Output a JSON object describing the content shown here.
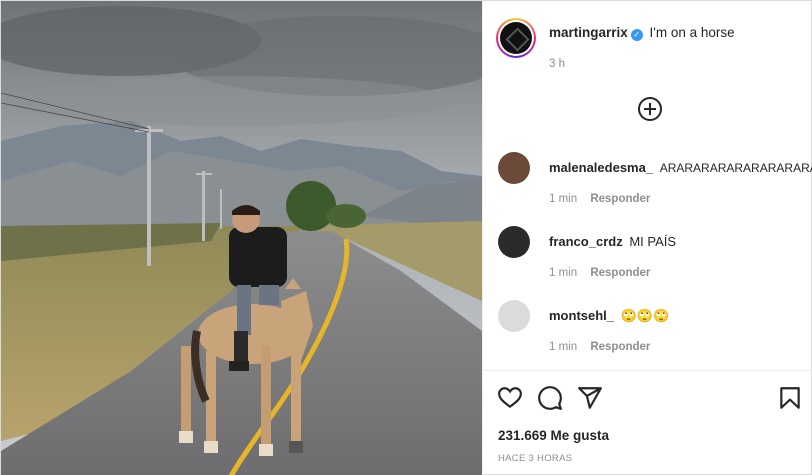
{
  "post": {
    "username": "martingarrix",
    "caption": "I'm on a horse",
    "time": "3 h",
    "verified_icon": "verified-badge-icon"
  },
  "comments": [
    {
      "username": "malenaledesma_",
      "text": "ARARARARARARARARARAR",
      "time": "1 min",
      "reply": "Responder",
      "avatar_color": "#6b4a3a"
    },
    {
      "username": "franco_crdz",
      "text": "MI PAÍS",
      "time": "1 min",
      "reply": "Responder",
      "avatar_color": "#2b2b2b"
    },
    {
      "username": "montsehl_",
      "text": "🙄🙄🙄",
      "time": "1 min",
      "reply": "Responder",
      "avatar_color": "#dbdbdb"
    }
  ],
  "actions": {
    "like_icon": "heart-icon",
    "comment_icon": "comment-icon",
    "share_icon": "send-icon",
    "save_icon": "bookmark-icon",
    "add_icon": "add-comment-icon"
  },
  "likes": "231.669 Me gusta",
  "posted_ago": "HACE 3 HORAS",
  "colors": {
    "accent": "#3897f0",
    "muted": "#8e8e8e",
    "text": "#262626"
  }
}
